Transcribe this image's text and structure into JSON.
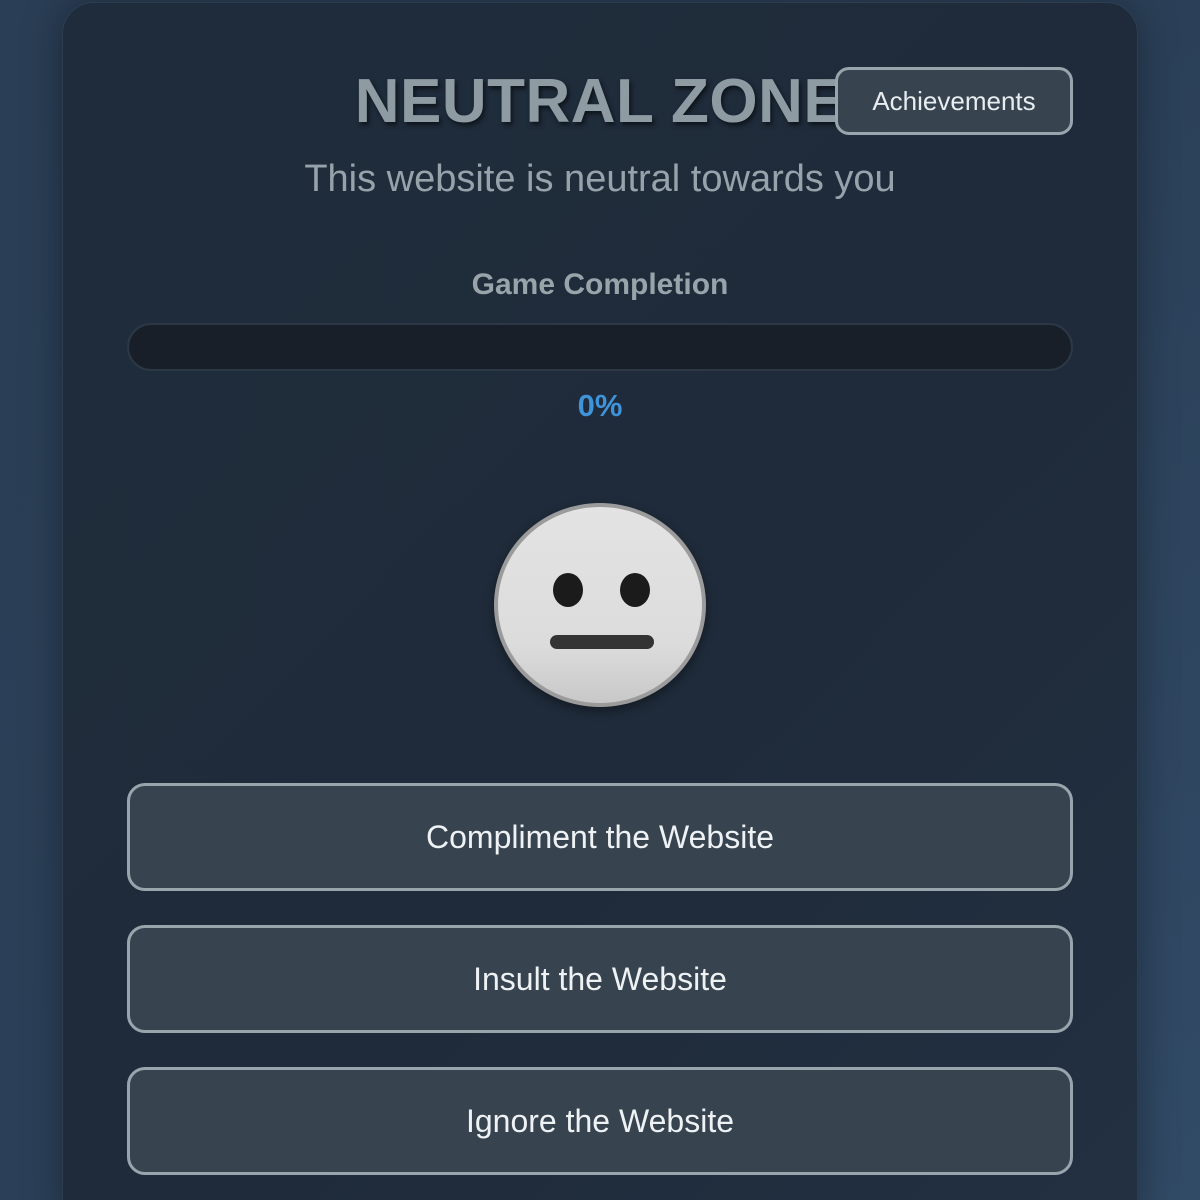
{
  "header": {
    "title": "NEUTRAL ZONE",
    "subtitle": "This website is neutral towards you",
    "achievements_label": "Achievements"
  },
  "progress": {
    "label": "Game Completion",
    "percent_text": "0%",
    "value": 0
  },
  "mood": {
    "icon": "neutral-face-icon"
  },
  "actions": [
    {
      "label": "Compliment the Website"
    },
    {
      "label": "Insult the Website"
    },
    {
      "label": "Ignore the Website"
    }
  ],
  "colors": {
    "accent": "#3f93d8",
    "background": "#2a3e55",
    "card": "#1f2c3b",
    "button": "#37434f",
    "button_border": "#98a5ad"
  }
}
